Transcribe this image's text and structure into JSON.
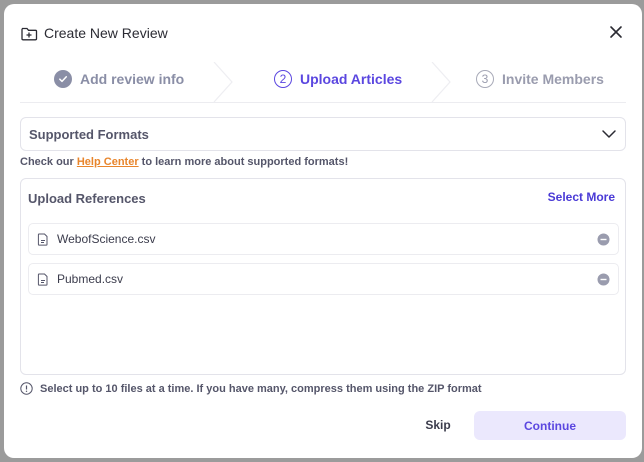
{
  "header": {
    "title": "Create New Review",
    "icon": "add-folder-icon"
  },
  "stepper": {
    "steps": [
      {
        "number": "1",
        "label": "Add review info",
        "state": "completed"
      },
      {
        "number": "2",
        "label": "Upload Articles",
        "state": "active"
      },
      {
        "number": "3",
        "label": "Invite Members",
        "state": "upcoming"
      }
    ]
  },
  "formats": {
    "label": "Supported Formats"
  },
  "help": {
    "prefix": "Check our",
    "link": "Help Center",
    "suffix": "to learn more about supported formats!"
  },
  "upload": {
    "title": "Upload References",
    "select_more": "Select More",
    "files": [
      {
        "name": "WebofScience.csv"
      },
      {
        "name": "Pubmed.csv"
      }
    ]
  },
  "info": {
    "text": "Select up to 10 files at a time. If you have many, compress them using the ZIP format"
  },
  "footer": {
    "skip_label": "Skip",
    "continue_label": "Continue"
  },
  "colors": {
    "accent": "#5b47e0",
    "link": "#e8852c",
    "continue_bg": "#ebe8fd"
  }
}
